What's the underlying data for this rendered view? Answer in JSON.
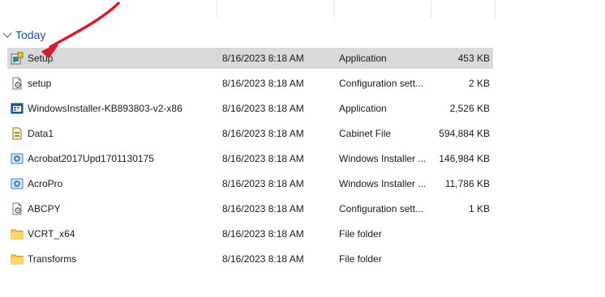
{
  "group": {
    "label": "Today"
  },
  "files": [
    {
      "name": "Setup",
      "date": "8/16/2023 8:18 AM",
      "type": "Application",
      "size": "453 KB",
      "icon": "installer-app-icon",
      "selected": true
    },
    {
      "name": "setup",
      "date": "8/16/2023 8:18 AM",
      "type": "Configuration sett...",
      "size": "2 KB",
      "icon": "config-file-icon",
      "selected": false
    },
    {
      "name": "WindowsInstaller-KB893803-v2-x86",
      "date": "8/16/2023 8:18 AM",
      "type": "Application",
      "size": "2,526 KB",
      "icon": "windows-app-icon",
      "selected": false
    },
    {
      "name": "Data1",
      "date": "8/16/2023 8:18 AM",
      "type": "Cabinet File",
      "size": "594,884 KB",
      "icon": "cabinet-file-icon",
      "selected": false
    },
    {
      "name": "Acrobat2017Upd1701130175",
      "date": "8/16/2023 8:18 AM",
      "type": "Windows Installer ...",
      "size": "146,984 KB",
      "icon": "msi-package-icon",
      "selected": false
    },
    {
      "name": "AcroPro",
      "date": "8/16/2023 8:18 AM",
      "type": "Windows Installer ...",
      "size": "11,786 KB",
      "icon": "msi-package-icon",
      "selected": false
    },
    {
      "name": "ABCPY",
      "date": "8/16/2023 8:18 AM",
      "type": "Configuration sett...",
      "size": "1 KB",
      "icon": "config-file-icon",
      "selected": false
    },
    {
      "name": "VCRT_x64",
      "date": "8/16/2023 8:18 AM",
      "type": "File folder",
      "size": "",
      "icon": "folder-icon",
      "selected": false
    },
    {
      "name": "Transforms",
      "date": "8/16/2023 8:18 AM",
      "type": "File folder",
      "size": "",
      "icon": "folder-icon",
      "selected": false
    }
  ],
  "colors": {
    "selection": "#d9d9d9",
    "group_header": "#1f4e8c",
    "annotation_arrow": "#d4202a",
    "folder": "#f4c64f"
  }
}
